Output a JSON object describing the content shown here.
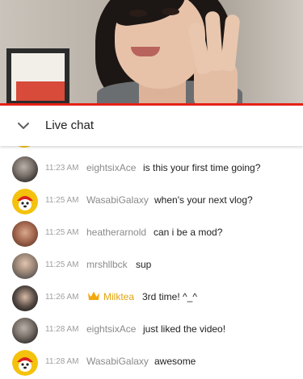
{
  "header": {
    "title": "Live chat",
    "collapse_icon": "chevron-down-icon"
  },
  "colors": {
    "progress": "#e62117",
    "moderator_name": "#e2a30d",
    "author_name": "#8a8a8a",
    "timestamp": "#9e9e9e"
  },
  "messages": [
    {
      "time": "11:23 AM",
      "author": "eightsixAce",
      "text": "is this your first time going?",
      "avatar": "photo-avatar"
    },
    {
      "time": "11:25 AM",
      "author": "WasabiGalaxy",
      "text": "when's your next vlog?",
      "avatar": "yellow-mascot-avatar"
    },
    {
      "time": "11:25 AM",
      "author": "heatherarnold",
      "text": "can i be a mod?",
      "avatar": "photo-avatar"
    },
    {
      "time": "11:25 AM",
      "author": "mrshllbck",
      "text": "sup",
      "avatar": "photo-avatar"
    },
    {
      "time": "11:26 AM",
      "author": "Milktea",
      "text": "3rd time! ^_^",
      "avatar": "photo-avatar",
      "badge": "crown-icon"
    },
    {
      "time": "11:28 AM",
      "author": "eightsixAce",
      "text": "just liked the video!",
      "avatar": "photo-avatar"
    },
    {
      "time": "11:28 AM",
      "author": "WasabiGalaxy",
      "text": "awesome",
      "avatar": "yellow-mascot-avatar"
    }
  ]
}
